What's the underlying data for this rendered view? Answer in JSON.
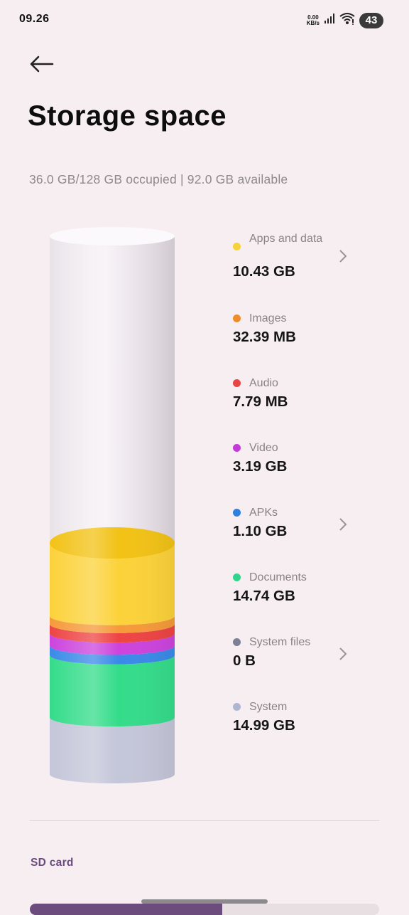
{
  "status_bar": {
    "time": "09.26",
    "net_speed_value": "0.00",
    "net_speed_unit": "KB/s",
    "battery": "43"
  },
  "header": {
    "title": "Storage space"
  },
  "summary": "36.0 GB/128 GB occupied | 92.0 GB available",
  "storage": {
    "occupied_fraction": 0.28,
    "segments": [
      {
        "name": "System",
        "color": "#c4c6d9"
      },
      {
        "name": "Documents",
        "color": "#34dc8a"
      },
      {
        "name": "APKs",
        "color": "#3a8ae8"
      },
      {
        "name": "Video",
        "color": "#cc44dd"
      },
      {
        "name": "Audio",
        "color": "#ee4444"
      },
      {
        "name": "Images",
        "color": "#f59a3a"
      },
      {
        "name": "Apps and data",
        "color": "#fcd23a"
      }
    ]
  },
  "legend": [
    {
      "label": "Apps and data",
      "size": "10.43 GB",
      "color": "#f6d23c",
      "chevron": true
    },
    {
      "label": "Images",
      "size": "32.39 MB",
      "color": "#f08c2a",
      "chevron": false
    },
    {
      "label": "Audio",
      "size": "7.79 MB",
      "color": "#e84444",
      "chevron": false
    },
    {
      "label": "Video",
      "size": "3.19 GB",
      "color": "#c43ad8",
      "chevron": false
    },
    {
      "label": "APKs",
      "size": "1.10 GB",
      "color": "#2f7fde",
      "chevron": true
    },
    {
      "label": "Documents",
      "size": "14.74 GB",
      "color": "#2fd58a",
      "chevron": false
    },
    {
      "label": "System files",
      "size": "0 B",
      "color": "#7d7f96",
      "chevron": true
    },
    {
      "label": "System",
      "size": "14.99 GB",
      "color": "#aeb7d1",
      "chevron": false
    }
  ],
  "sd_card": {
    "label": "SD card",
    "used_fraction": 0.55
  },
  "icons": {
    "back": "back-arrow-icon",
    "chevron": "chevron-right-icon",
    "signal": "signal-icon",
    "wifi": "wifi-icon"
  }
}
